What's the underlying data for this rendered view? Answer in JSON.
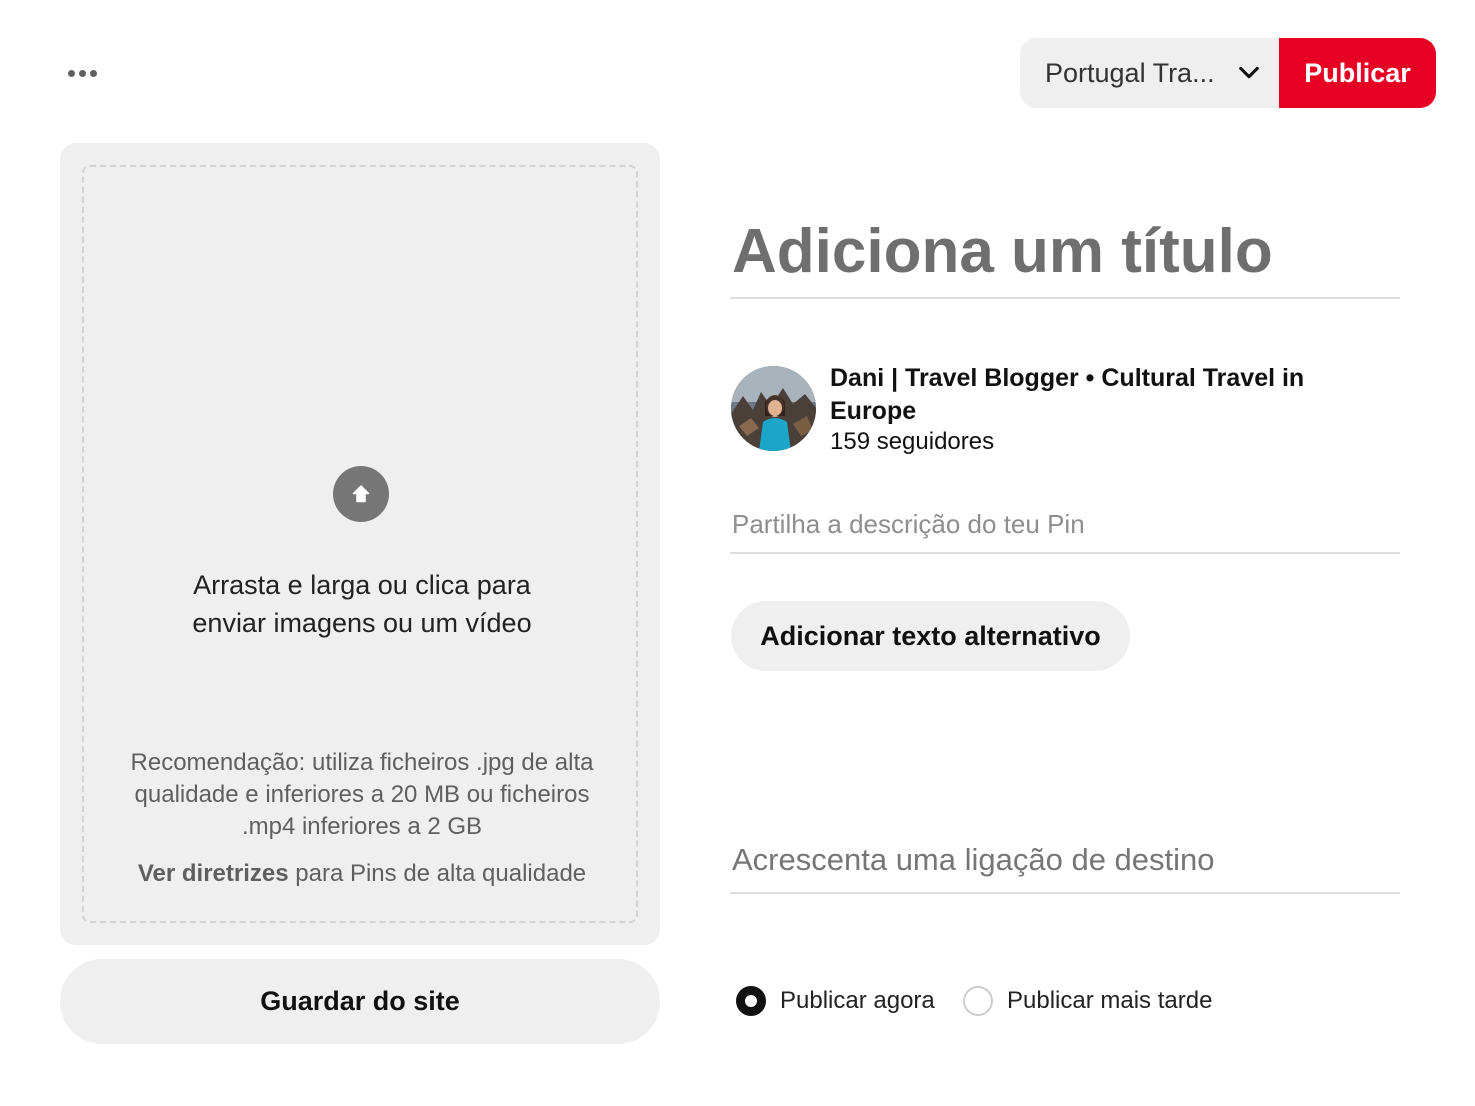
{
  "topbar": {
    "board_name": "Portugal Tra...",
    "publish_label": "Publicar",
    "accent_color": "#e60023"
  },
  "upload": {
    "instruction": "Arrasta e larga ou clica para\nenviar imagens ou um vídeo",
    "recommendation": "Recomendação: utiliza ficheiros .jpg de alta qualidade e inferiores a 20 MB ou ficheiros .mp4 inferiores a 2 GB",
    "guidelines_link": "Ver diretrizes",
    "guidelines_rest": " para Pins de alta qualidade",
    "icon": "arrow-up-icon"
  },
  "save_from_site_label": "Guardar do site",
  "form": {
    "title_placeholder": "Adiciona um título",
    "profile": {
      "name": "Dani | Travel Blogger • Cultural Travel in Europe",
      "followers": "159 seguidores"
    },
    "description_placeholder": "Partilha a descrição do teu Pin",
    "alt_text_label": "Adicionar texto alternativo",
    "link_placeholder": "Acrescenta uma ligação de destino",
    "publish_options": [
      {
        "label": "Publicar agora",
        "selected": true
      },
      {
        "label": "Publicar mais tarde",
        "selected": false
      }
    ]
  }
}
